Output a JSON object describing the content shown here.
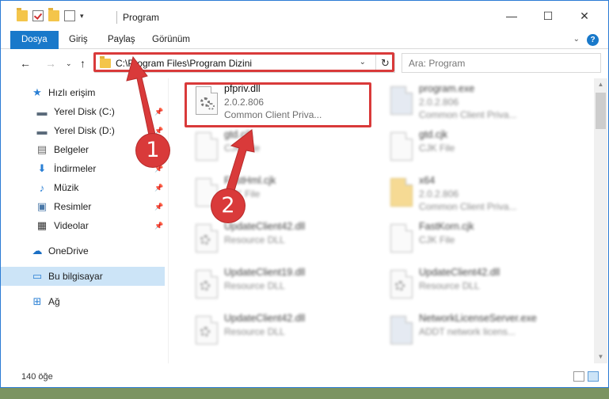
{
  "window": {
    "title": "Program"
  },
  "ribbon": {
    "tabs": [
      "Dosya",
      "Giriş",
      "Paylaş",
      "Görünüm"
    ],
    "help": "?"
  },
  "address": {
    "path": "C:\\Program Files\\Program Dizini"
  },
  "search": {
    "placeholder": "Ara: Program"
  },
  "sidebar": {
    "items": [
      {
        "label": "Hızlı erişim",
        "icon": "star-icon"
      },
      {
        "label": "Yerel Disk (C:)",
        "icon": "drive-icon"
      },
      {
        "label": "Yerel Disk (D:)",
        "icon": "drive-icon"
      },
      {
        "label": "Belgeler",
        "icon": "documents-icon"
      },
      {
        "label": "İndirmeler",
        "icon": "download-icon"
      },
      {
        "label": "Müzik",
        "icon": "music-icon"
      },
      {
        "label": "Resimler",
        "icon": "pictures-icon"
      },
      {
        "label": "Videolar",
        "icon": "videos-icon"
      },
      {
        "label": "OneDrive",
        "icon": "cloud-icon"
      },
      {
        "label": "Bu bilgisayar",
        "icon": "computer-icon"
      },
      {
        "label": "Ağ",
        "icon": "network-icon"
      }
    ]
  },
  "files": [
    {
      "name": "pfpriv.dll",
      "line1": "2.0.2.806",
      "line2": "Common Client Priva..."
    },
    {
      "name": "program.exe",
      "line1": "2.0.2.806",
      "line2": "Common Client Priva..."
    },
    {
      "name": "gtd.cjk",
      "line1": "CJK File",
      "line2": ""
    },
    {
      "name": "gtd.cjk",
      "line1": "CJK File",
      "line2": ""
    },
    {
      "name": "FastHml.cjk",
      "line1": "CJK File",
      "line2": ""
    },
    {
      "name": "x64",
      "line1": "2.0.2.806",
      "line2": "Common Client Priva..."
    },
    {
      "name": "UpdateClient42.dll",
      "line1": "Resource DLL",
      "line2": ""
    },
    {
      "name": "FastKorn.cjk",
      "line1": "CJK File",
      "line2": ""
    },
    {
      "name": "UpdateClient19.dll",
      "line1": "Resource DLL",
      "line2": ""
    },
    {
      "name": "UpdateClient42.dll",
      "line1": "Resource DLL",
      "line2": ""
    },
    {
      "name": "UpdateClient42.dll",
      "line1": "Resource DLL",
      "line2": ""
    },
    {
      "name": "NetworkLicenseServer.exe",
      "line1": "ADDT network licens...",
      "line2": ""
    }
  ],
  "status": {
    "count": "140 öğe"
  },
  "annotations": {
    "step1": "1",
    "step2": "2",
    "color": "#d93a3a"
  }
}
